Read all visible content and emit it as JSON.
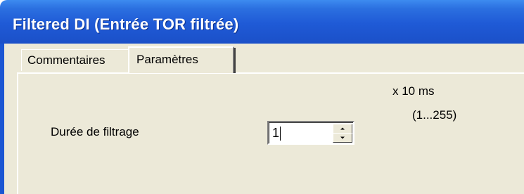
{
  "window": {
    "title": "Filtered DI (Entrée TOR filtrée)"
  },
  "tabs": [
    {
      "label": "Commentaires",
      "active": false
    },
    {
      "label": "Paramètres",
      "active": true
    }
  ],
  "params": {
    "filter_duration_label": "Durée de filtrage",
    "filter_duration_value": "1",
    "unit": "x 10 ms",
    "range": "(1...255)"
  },
  "colors": {
    "titlebar": "#1f5ad6",
    "dialog_bg": "#ece9d8"
  },
  "icons": {
    "spin_up": "arrow-up-icon",
    "spin_down": "arrow-down-icon"
  }
}
